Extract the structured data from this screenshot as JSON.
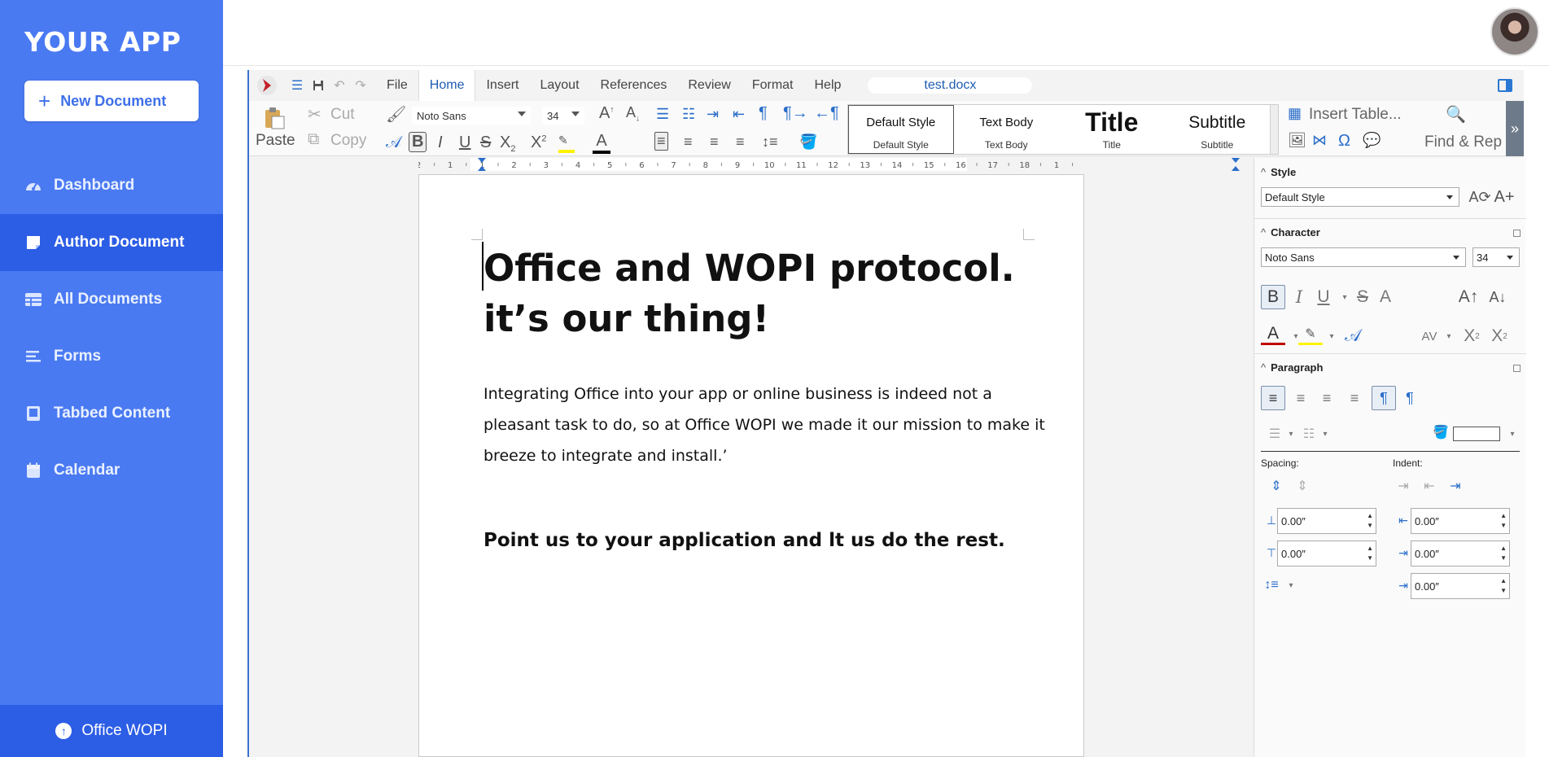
{
  "app": {
    "brand": "YOUR APP",
    "new_document": "New Document",
    "nav": [
      {
        "label": "Dashboard",
        "icon": "gauge-icon"
      },
      {
        "label": "Author Document",
        "icon": "note-icon",
        "active": true
      },
      {
        "label": "All Documents",
        "icon": "table-icon"
      },
      {
        "label": "Forms",
        "icon": "lines-icon"
      },
      {
        "label": "Tabbed Content",
        "icon": "tablet-icon"
      },
      {
        "label": "Calendar",
        "icon": "calendar-icon"
      }
    ],
    "footer": "Office WOPI",
    "accent": "#4a7af2",
    "accent_dark": "#2c5de5"
  },
  "office": {
    "menu": [
      "File",
      "Home",
      "Insert",
      "Layout",
      "References",
      "Review",
      "Format",
      "Help"
    ],
    "active_menu": "Home",
    "doc_name": "test.docx",
    "ribbon": {
      "paste": "Paste",
      "cut": "Cut",
      "copy": "Copy",
      "font": "Noto Sans",
      "size": "34",
      "insert_table": "Insert Table...",
      "find_replace": "Find & Rep",
      "styles": [
        {
          "name": "Default Style",
          "label": "Default Style"
        },
        {
          "name": "Text Body",
          "label": "Text Body"
        },
        {
          "name": "Title",
          "label": "Title"
        },
        {
          "name": "Subtitle",
          "label": "Subtitle"
        }
      ]
    },
    "ruler_labels": [
      "2",
      "1",
      "1",
      "2",
      "3",
      "4",
      "5",
      "6",
      "7",
      "8",
      "9",
      "10",
      "11",
      "12",
      "13",
      "14",
      "15",
      "16",
      "17",
      "18",
      "1"
    ],
    "document": {
      "title": "Office and WOPI protocol. it’s our thing!",
      "paragraph": "Integrating Office into your app or online business is indeed not a pleasant task to do, so at Office WOPI we made it our mission to make it breeze to integrate and install.’",
      "bold_line": "Point us to your application and lt us do the rest."
    },
    "panel": {
      "style_header": "Style",
      "style_value": "Default Style",
      "character_header": "Character",
      "font_value": "Noto Sans",
      "size_value": "34",
      "paragraph_header": "Paragraph",
      "spacing_label": "Spacing:",
      "indent_label": "Indent:",
      "spin_values": [
        "0.00″",
        "0.00″",
        "0.00″",
        "0.00″",
        "0.00″"
      ]
    }
  }
}
